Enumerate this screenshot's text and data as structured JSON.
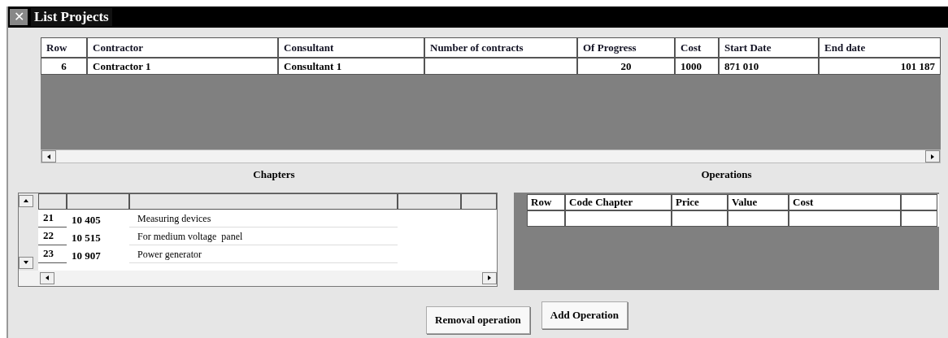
{
  "window": {
    "title": "List Projects",
    "close": "✕"
  },
  "projects": {
    "columns": [
      "Row",
      "Contractor",
      "Consultant",
      "Number of contracts",
      "Of Progress",
      "Cost",
      "Start Date",
      "End date"
    ],
    "rows": [
      [
        "6",
        "Contractor 1",
        "Consultant 1",
        "",
        "20",
        "1000",
        "871 010",
        "101 187"
      ]
    ]
  },
  "chapters": {
    "title": "Chapters",
    "rows": [
      {
        "row": "21",
        "code": "10 405",
        "description": "Measuring devices"
      },
      {
        "row": "22",
        "code": "10 515",
        "description": "For medium voltage  panel"
      },
      {
        "row": "23",
        "code": "10 907",
        "description": "Power generator"
      }
    ]
  },
  "operations": {
    "title": "Operations",
    "columns": [
      "Row",
      "Code Chapter",
      "Price",
      "Value",
      "Cost"
    ]
  },
  "buttons": [
    "Removal operation",
    "Add Operation"
  ]
}
